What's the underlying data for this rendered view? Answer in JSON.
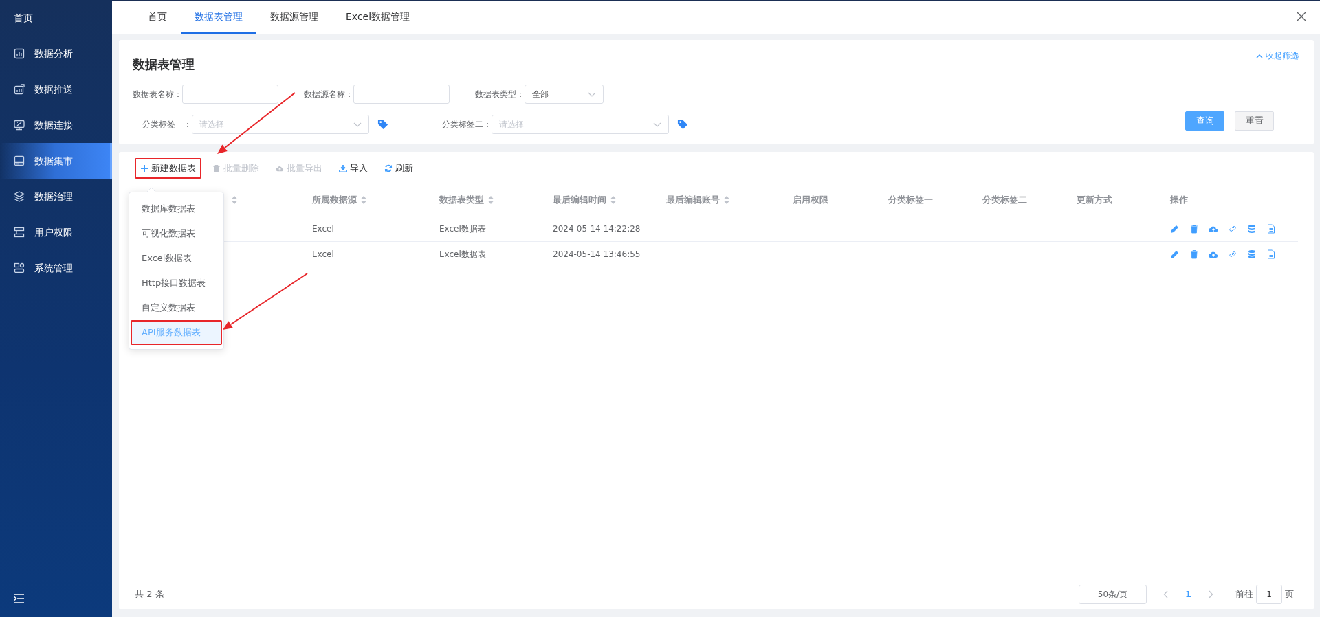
{
  "sidebar": {
    "home": "首页",
    "items": [
      {
        "label": "数据分析",
        "selected": false
      },
      {
        "label": "数据推送",
        "selected": false
      },
      {
        "label": "数据连接",
        "selected": false
      },
      {
        "label": "数据集市",
        "selected": true
      },
      {
        "label": "数据治理",
        "selected": false
      },
      {
        "label": "用户权限",
        "selected": false
      },
      {
        "label": "系统管理",
        "selected": false
      }
    ]
  },
  "tabs": [
    {
      "label": "首页",
      "selected": false
    },
    {
      "label": "数据表管理",
      "selected": true
    },
    {
      "label": "数据源管理",
      "selected": false
    },
    {
      "label": "Excel数据管理",
      "selected": false
    }
  ],
  "filter": {
    "title": "数据表管理",
    "collapse_link": "收起筛选",
    "row_1": [
      {
        "kind": "input",
        "label": "数据表名称："
      },
      {
        "kind": "input",
        "label": "数据源名称："
      },
      {
        "kind": "select",
        "label": "数据表类型：",
        "value": "全部"
      }
    ],
    "row_2": [
      {
        "kind": "tag-select",
        "label": "分类标签一：",
        "placeholder": "请选择"
      },
      {
        "kind": "tag-select",
        "label": "分类标签二：",
        "placeholder": "请选择"
      }
    ],
    "buttons": [
      {
        "kind": "primary",
        "label": "查询"
      },
      {
        "kind": "secondary",
        "label": "重置"
      }
    ]
  },
  "toolbar": [
    {
      "kind": "plus",
      "label": "新建数据表",
      "disabled": false,
      "highlighted": true
    },
    {
      "kind": "trash",
      "label": "批量删除",
      "disabled": true,
      "highlighted": false
    },
    {
      "kind": "cloud",
      "label": "批量导出",
      "disabled": true,
      "highlighted": false
    },
    {
      "kind": "download",
      "label": "导入",
      "disabled": false,
      "highlighted": false
    },
    {
      "kind": "refresh",
      "label": "刷新",
      "disabled": false,
      "highlighted": false
    }
  ],
  "dropdown": {
    "items": [
      {
        "label": "数据库数据表",
        "selected": false,
        "highlighted": false
      },
      {
        "label": "可视化数据表",
        "selected": false,
        "highlighted": false
      },
      {
        "label": "Excel数据表",
        "selected": false,
        "highlighted": false
      },
      {
        "label": "Http接口数据表",
        "selected": false,
        "highlighted": false
      },
      {
        "label": "自定义数据表",
        "selected": false,
        "highlighted": false
      },
      {
        "label": "API服务数据表",
        "selected": true,
        "highlighted": true
      }
    ]
  },
  "table": {
    "columns": [
      {
        "sortable": true
      },
      {
        "label": "所属数据源",
        "sortable": true
      },
      {
        "label": "数据表类型",
        "sortable": true
      },
      {
        "label": "最后编辑时间",
        "sortable": true
      },
      {
        "label": "最后编辑账号",
        "sortable": true
      },
      {
        "label": "启用权限",
        "sortable": false
      },
      {
        "label": "分类标签一",
        "sortable": false
      },
      {
        "label": "分类标签二",
        "sortable": false
      },
      {
        "label": "更新方式",
        "sortable": false
      },
      {
        "label": "操作",
        "sortable": false
      }
    ],
    "rows": [
      {
        "data_source": "Excel",
        "table_type": "Excel数据表",
        "last_edit_time": "2024-05-14 14:22:28"
      },
      {
        "data_source": "Excel",
        "table_type": "Excel数据表",
        "last_edit_time": "2024-05-14 13:46:55"
      }
    ]
  },
  "pagination": {
    "total": "共 2 条",
    "page_size": "50条/页",
    "pages": [
      {
        "label": "1",
        "selected": true
      }
    ],
    "goto_label": "前往",
    "goto_value": "1",
    "goto_suffix": "页"
  }
}
